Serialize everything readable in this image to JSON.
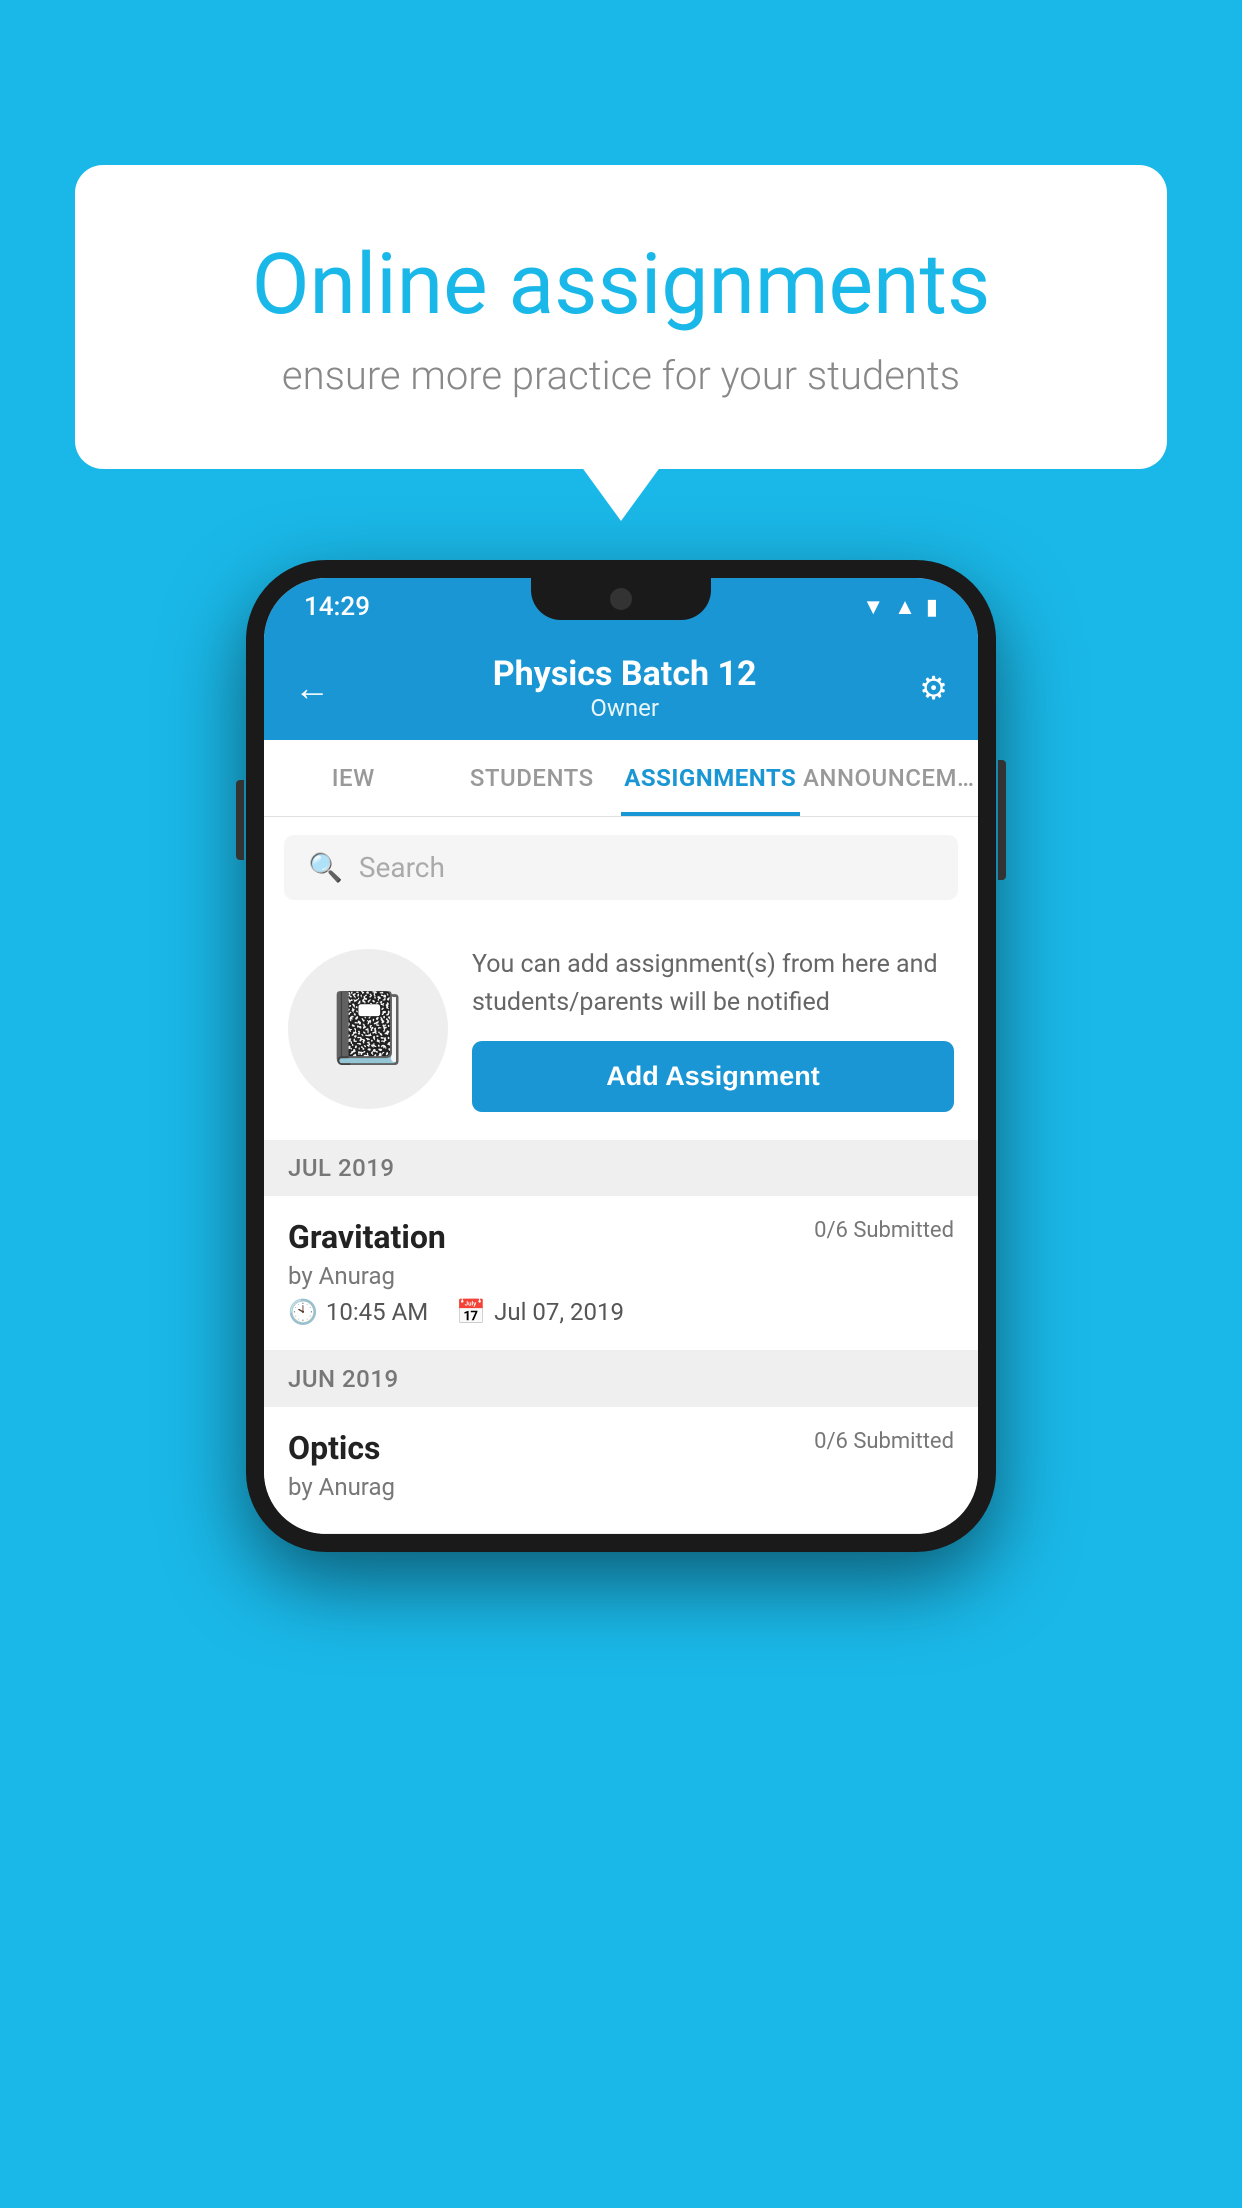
{
  "background_color": "#1ab8e8",
  "speech_bubble": {
    "heading": "Online assignments",
    "subheading": "ensure more practice for your students"
  },
  "status_bar": {
    "time": "14:29",
    "icons": [
      "wifi",
      "signal",
      "battery"
    ]
  },
  "app_bar": {
    "title": "Physics Batch 12",
    "subtitle": "Owner",
    "back_label": "←",
    "settings_label": "⚙"
  },
  "tabs": [
    {
      "label": "IEW",
      "active": false
    },
    {
      "label": "STUDENTS",
      "active": false
    },
    {
      "label": "ASSIGNMENTS",
      "active": true
    },
    {
      "label": "ANNOUNCEM…",
      "active": false
    }
  ],
  "search": {
    "placeholder": "Search"
  },
  "promo": {
    "description": "You can add assignment(s) from here and students/parents will be notified",
    "add_button_label": "Add Assignment"
  },
  "assignment_sections": [
    {
      "month_label": "JUL 2019",
      "assignments": [
        {
          "title": "Gravitation",
          "submitted": "0/6 Submitted",
          "by": "by Anurag",
          "time": "10:45 AM",
          "date": "Jul 07, 2019"
        }
      ]
    },
    {
      "month_label": "JUN 2019",
      "assignments": [
        {
          "title": "Optics",
          "submitted": "0/6 Submitted",
          "by": "by Anurag",
          "time": "",
          "date": ""
        }
      ]
    }
  ]
}
